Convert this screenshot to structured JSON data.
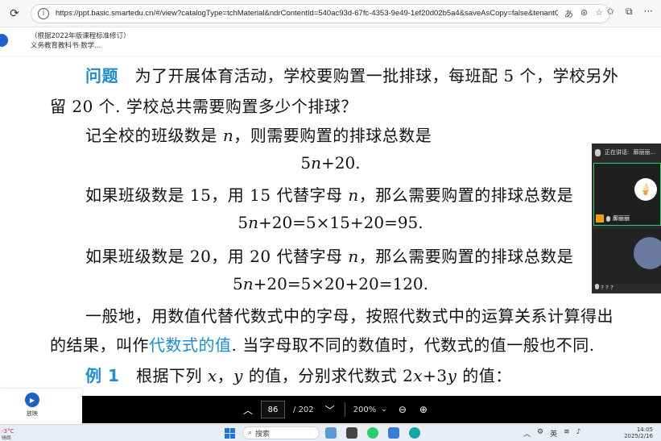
{
  "browser": {
    "url": "https://ppt.basic.smartedu.cn/#/view?catalogType=tchMaterial&ndrContentId=540ac93d-67fc-4353-9e49-1ef20d02b5a4&saveAsCopy=false&tenantCode=zxx",
    "refresh_icon": "refresh-icon",
    "translate_label": "あ",
    "more_label": "···"
  },
  "header": {
    "book_title": "（根据2022年版课程标准修订）义务教育教科书·数学..."
  },
  "document": {
    "problem_tag": "问题",
    "problem_line1": "为了开展体育活动，学校要购置一批排球，每班配 5 个，学校另外",
    "problem_line2": "留 20 个. 学校总共需要购置多少个排球？",
    "line3a": "记全校的班级数是 ",
    "var_n": "n",
    "line3b": "，则需要购置的排球总数是",
    "expr1_a": "5",
    "expr1_b": "+20.",
    "line5a": "如果班级数是 15，用 15 代替字母 ",
    "line5b": "，那么需要购置的排球总数是",
    "expr2_a": "5",
    "expr2_b": "+20=5×15+20=95.",
    "line7a": "如果班级数是 20，用 20 代替字母 ",
    "line7b": "，那么需要购置的排球总数是",
    "expr3_a": "5",
    "expr3_b": "+20=5×20+20=120.",
    "line9": "一般地，用数值代替代数式中的字母，按照代数式中的运算关系计算得出",
    "line10a": "的结果，叫作",
    "term": "代数式的值",
    "line10b": ". 当字母取不同的数值时，代数式的值一般也不同.",
    "example_tag": "例 1",
    "line11a": "根据下列 ",
    "var_x": "x",
    "line11b": "，",
    "var_y": "y",
    "line11c": " 的值，分别求代数式 2",
    "line11d": "+3",
    "line11e": " 的值："
  },
  "video_panel": {
    "speaking_label": "正在讲话:",
    "speaker_name": "廓丽丽...",
    "tile_name": "廓丽丽",
    "footer": "? ? ?"
  },
  "pdf_toolbar": {
    "current_page": "86",
    "total_pages": "/ 202",
    "zoom": "200%"
  },
  "play_widget": {
    "label": "放映"
  },
  "taskbar": {
    "temp": "-3°C",
    "weather_sub": "晴朗",
    "search_label": "搜索",
    "ime": "英",
    "time": "14:05",
    "date": "2025/2/16"
  },
  "colors": {
    "accent_blue": "#1d8bd6",
    "toolbar_bg": "#000000",
    "speaker_border": "#2ecc71"
  }
}
